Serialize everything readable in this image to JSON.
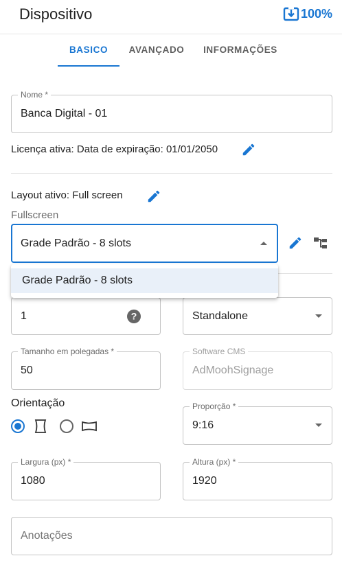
{
  "header": {
    "title": "Dispositivo",
    "battery": "100%"
  },
  "tabs": [
    {
      "label": "BASICO",
      "active": true
    },
    {
      "label": "AVANÇADO",
      "active": false
    },
    {
      "label": "INFORMAÇÕES",
      "active": false
    }
  ],
  "nome": {
    "label": "Nome *",
    "value": "Banca Digital - 01"
  },
  "licenca": {
    "text": "Licença ativa: Data de expiração: 01/01/2050"
  },
  "layout": {
    "text": "Layout ativo: Full screen",
    "select_label": "Fullscreen",
    "select_value": "Grade Padrão - 8 slots",
    "options": [
      "Grade Padrão - 8 slots"
    ]
  },
  "passo": {
    "value": "1"
  },
  "tipo": {
    "value": "Standalone"
  },
  "tamanho": {
    "label": "Tamanho em polegadas *",
    "value": "50"
  },
  "software": {
    "label": "Software CMS",
    "value": "AdMoohSignage"
  },
  "orientacao": {
    "label": "Orientação",
    "selected": "portrait"
  },
  "proporcao": {
    "label": "Proporção *",
    "value": "9:16"
  },
  "largura": {
    "label": "Largura (px) *",
    "value": "1080"
  },
  "altura": {
    "label": "Altura (px) *",
    "value": "1920"
  },
  "anotacoes": {
    "placeholder": "Anotações"
  },
  "colors": {
    "accent": "#1976d2",
    "border": "#c4c4c4",
    "highlight": "#e9f0f9"
  }
}
